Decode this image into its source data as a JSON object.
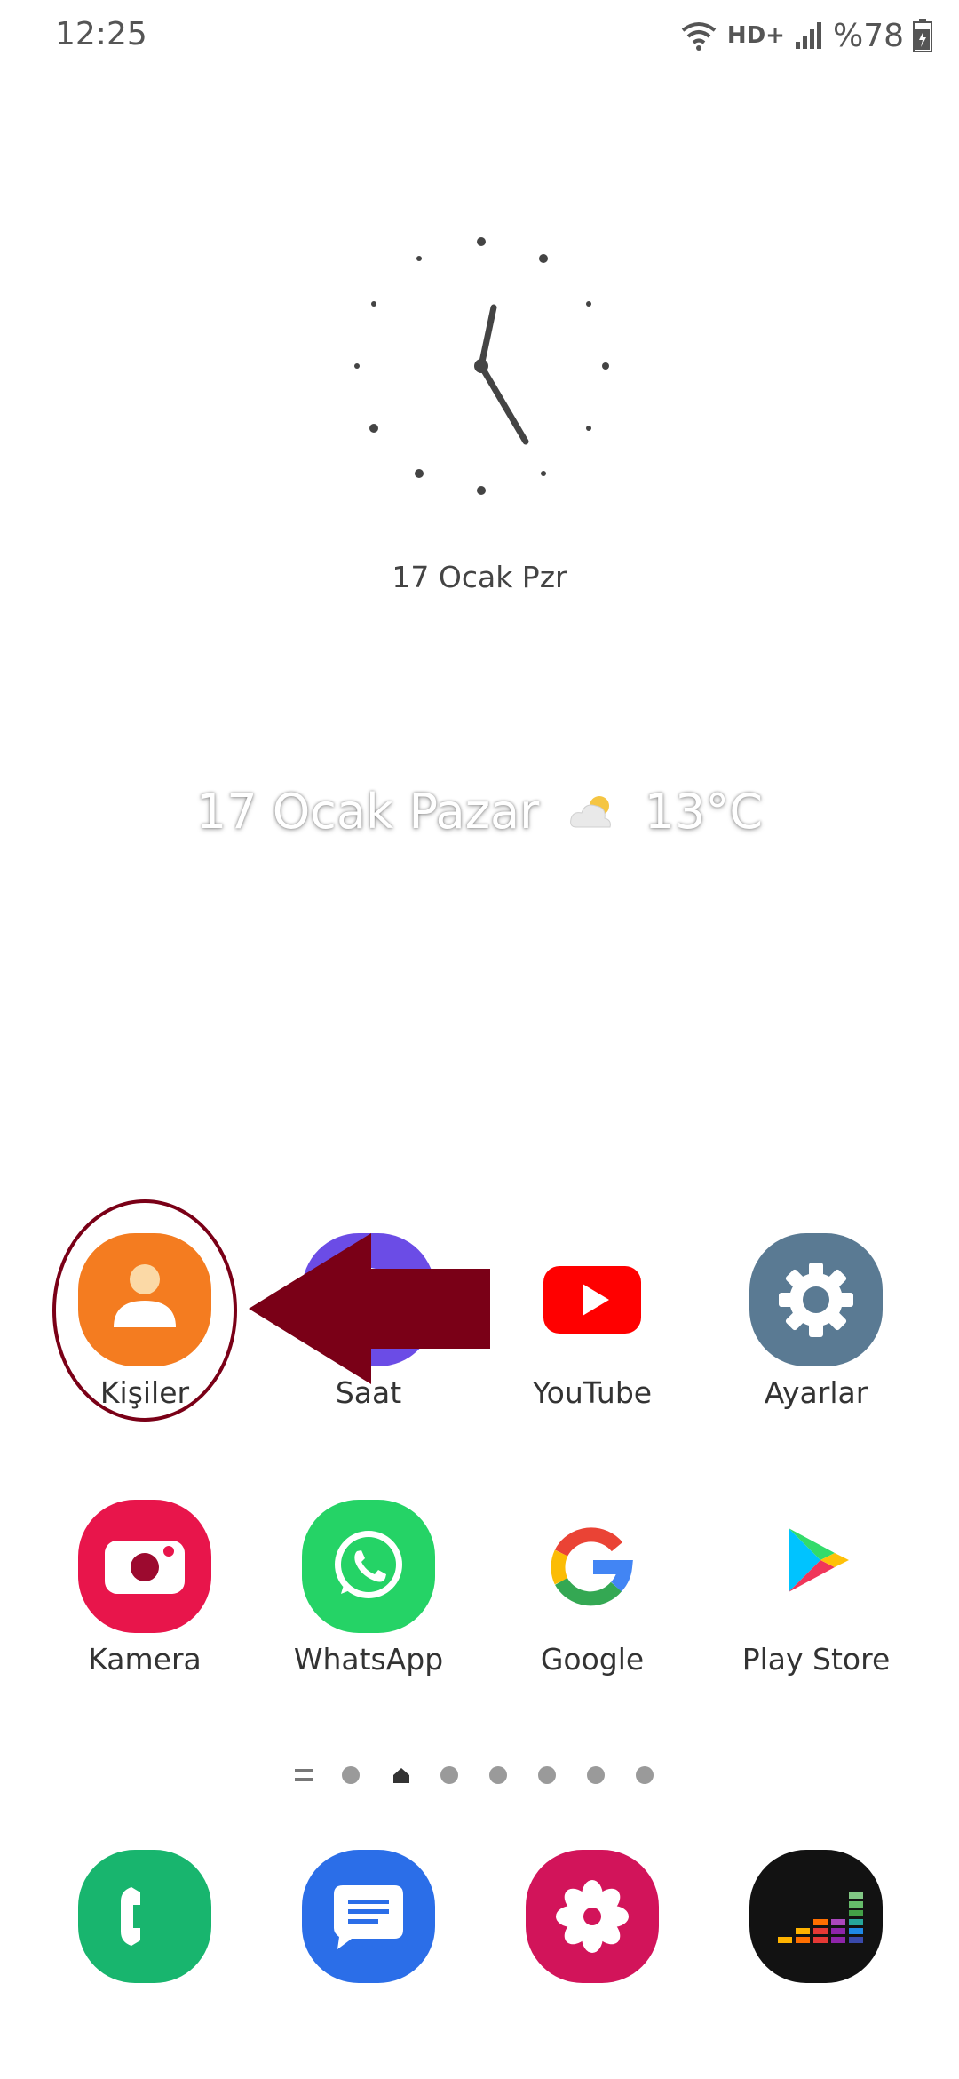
{
  "status_bar": {
    "time": "12:25",
    "network": "HD+",
    "battery": "%78"
  },
  "clock_widget": {
    "date": "17 Ocak Pzr"
  },
  "weather_widget": {
    "date": "17 Ocak Pazar",
    "temperature": "13°C"
  },
  "apps_row1": [
    {
      "label": "Kişiler",
      "icon": "contacts-icon",
      "color": "#F47C20"
    },
    {
      "label": "Saat",
      "icon": "clock-icon",
      "color": "#6B4CE6"
    },
    {
      "label": "YouTube",
      "icon": "youtube-icon",
      "color": "#FF0000"
    },
    {
      "label": "Ayarlar",
      "icon": "gear-icon",
      "color": "#5A7A93"
    }
  ],
  "apps_row2": [
    {
      "label": "Kamera",
      "icon": "camera-icon",
      "color": "#E8154B"
    },
    {
      "label": "WhatsApp",
      "icon": "whatsapp-icon",
      "color": "#25D366"
    },
    {
      "label": "Google",
      "icon": "google-icon",
      "color": "#FFFFFF"
    },
    {
      "label": "Play Store",
      "icon": "play-store-icon",
      "color": "#FFFFFF"
    }
  ],
  "dock": [
    {
      "icon": "phone-icon",
      "color": "#18B56E"
    },
    {
      "icon": "messages-icon",
      "color": "#2B6EE8"
    },
    {
      "icon": "gallery-icon",
      "color": "#D2145A"
    },
    {
      "icon": "deezer-icon",
      "color": "#121212"
    }
  ],
  "annotation_color": "#7A0017"
}
